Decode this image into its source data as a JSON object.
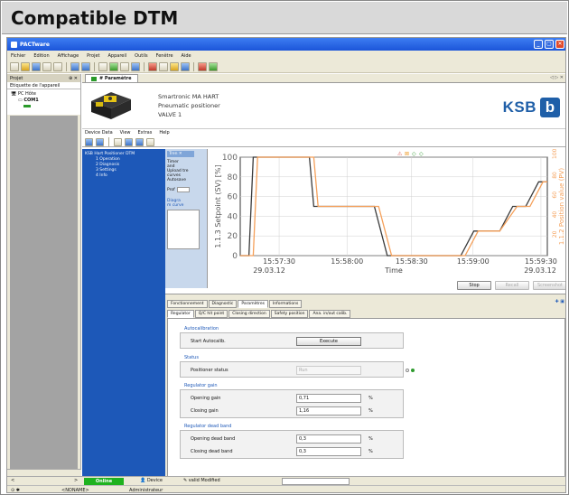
{
  "banner": {
    "title": "Compatible DTM"
  },
  "window": {
    "title": "PACTware"
  },
  "menu": [
    "Fichier",
    "Edition",
    "Affichage",
    "Projet",
    "Appareil",
    "Outils",
    "Fenêtre",
    "Aide"
  ],
  "project_panel": {
    "header": "Projet",
    "header_ctl": "⊕ ✕",
    "column": "Etiquette de l'appareil",
    "tree": [
      {
        "label": "PC Hôte",
        "level": 1
      },
      {
        "label": "COM1",
        "level": 2
      }
    ]
  },
  "doc_tab": {
    "label": "# Paramètre",
    "controls": "◁ ▷ ✕"
  },
  "device": {
    "line1": "Smartronic MA HART",
    "line2": "Pneumatic positioner",
    "line3": "VALVE 1"
  },
  "logo": {
    "text": "KSB",
    "mark": "b"
  },
  "device_menu": [
    "Device Data",
    "View",
    "Extras",
    "Help"
  ],
  "nav_tree": [
    {
      "label": "KSB Hart Positioner DTM",
      "level": 1
    },
    {
      "label": "1 Operation",
      "level": 2
    },
    {
      "label": "2 Diagnosis",
      "level": 2
    },
    {
      "label": "3 Settings",
      "level": 2
    },
    {
      "label": "4 Info",
      "level": 2
    }
  ],
  "left_ctrl": {
    "tab": "Tren ✕",
    "lines": [
      "Timer",
      "and",
      "Upload tre",
      "curves",
      "Autosave"
    ],
    "prof": "Prof",
    "diag": "Diagra",
    "diag2": "m curve"
  },
  "chart_data": {
    "type": "line",
    "ylabel_left": "1.1.3 Setpoint (SV) [%]",
    "ylabel_right": "1.1.2 Position value (PV)",
    "xlabel": "Time",
    "yticks": [
      0,
      20,
      40,
      60,
      80,
      100
    ],
    "ylim": [
      0,
      100
    ],
    "right_ticks": [
      20,
      40,
      60,
      80,
      100
    ],
    "xticks": [
      "15:57:30",
      "15:58:00",
      "15:58:30",
      "15:59:00",
      "15:59:30"
    ],
    "date_left": "29.03.12",
    "date_right": "29.03.12",
    "series": [
      {
        "name": "1.1.3 Setpoint (SV) [%]",
        "color": "#3a3a3a",
        "x": [
          0,
          2,
          3,
          10,
          12,
          16,
          17,
          26,
          28,
          31,
          34,
          41,
          44,
          51,
          54,
          60,
          63,
          66,
          69,
          71
        ],
        "y": [
          0,
          0,
          100,
          100,
          100,
          100,
          50,
          50,
          50,
          50,
          0,
          0,
          0,
          0,
          25,
          25,
          50,
          50,
          75,
          75
        ]
      },
      {
        "name": "1.1.2 Position value (PV)",
        "color": "#f5a05a",
        "x": [
          0,
          3,
          4,
          10,
          14,
          17,
          18,
          26,
          29,
          32,
          35,
          41,
          45,
          52,
          55,
          60,
          64,
          67,
          70,
          71
        ],
        "y": [
          0,
          0,
          100,
          100,
          100,
          100,
          50,
          50,
          50,
          50,
          0,
          0,
          0,
          0,
          25,
          25,
          50,
          50,
          75,
          75
        ]
      }
    ],
    "status_icons": [
      "⚠",
      "⊠",
      "◇",
      "◇"
    ]
  },
  "chart_buttons": [
    "Stop",
    "Recall",
    "Screenshot"
  ],
  "tabs_main": [
    "Fonctionnement",
    "Diagnostic",
    "Paramètres",
    "Informations"
  ],
  "tabs_sub": [
    "Regulator",
    "Q/C hit point",
    "Closing direction",
    "Safety position",
    "Ana. in/out calib."
  ],
  "sections": {
    "autocal": {
      "title": "Autocalibration",
      "label": "Start Autocalib.",
      "button": "Execute"
    },
    "status": {
      "title": "Status",
      "label": "Positioner status",
      "value": "Run"
    },
    "gain": {
      "title": "Regulator gain",
      "rows": [
        {
          "label": "Opening gain",
          "value": "0,71",
          "unit": "%"
        },
        {
          "label": "Closing gain",
          "value": "1,16",
          "unit": "%"
        }
      ]
    },
    "deadband": {
      "title": "Regulator dead band",
      "rows": [
        {
          "label": "Opening dead band",
          "value": "0,3",
          "unit": "%"
        },
        {
          "label": "Closing dead band",
          "value": "0,3",
          "unit": "%"
        }
      ]
    }
  },
  "statusbar": {
    "online": "Online",
    "device": "Device",
    "modified": "valid Modified",
    "noname": "<NONAME>",
    "user": "Administrateur",
    "icons": "⊙ ✱"
  }
}
